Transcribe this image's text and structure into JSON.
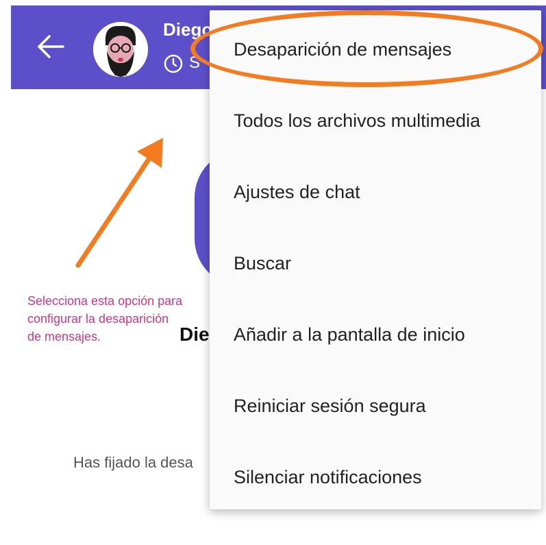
{
  "header": {
    "contact_name": "Diego",
    "subtitle": "S"
  },
  "body": {
    "name_partial": "Die",
    "info_partial": "Has fijado la desa"
  },
  "annotation": {
    "line1": "Selecciona esta opción para",
    "line2": "configurar la desaparición",
    "line3": "de mensajes."
  },
  "menu": {
    "items": [
      {
        "label": "Desaparición de mensajes"
      },
      {
        "label": "Todos los archivos multimedia"
      },
      {
        "label": "Ajustes de chat"
      },
      {
        "label": "Buscar"
      },
      {
        "label": "Añadir a la pantalla de inicio"
      },
      {
        "label": "Reiniciar sesión segura"
      },
      {
        "label": "Silenciar notificaciones"
      }
    ]
  },
  "colors": {
    "app_bar": "#5d4fc9",
    "annotation": "#d63384",
    "highlight": "#f47c20"
  }
}
